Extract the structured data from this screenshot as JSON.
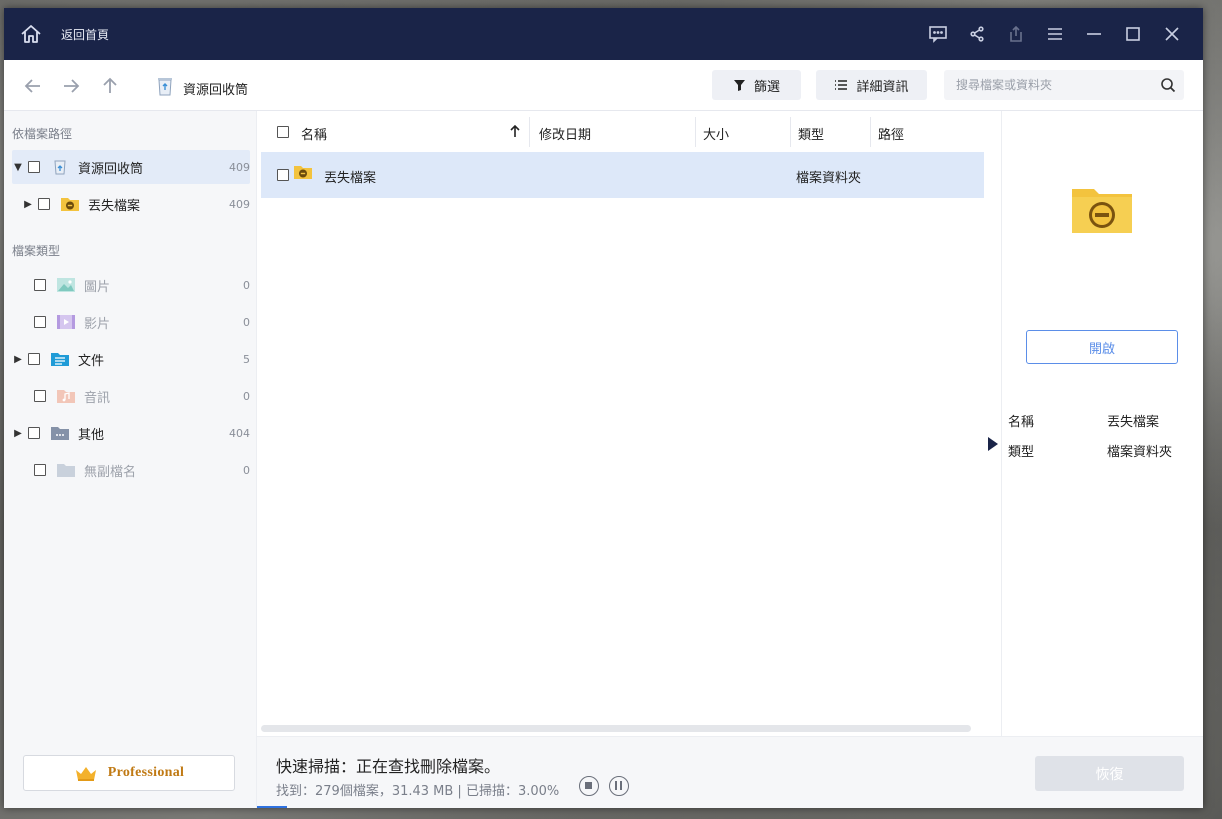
{
  "titlebar": {
    "back_home_label": "返回首頁",
    "icons": [
      "feedback-icon",
      "share-icon",
      "export-icon",
      "menu-icon",
      "minimize-icon",
      "maximize-icon",
      "close-icon"
    ]
  },
  "toolbar": {
    "current_path": "資源回收筒",
    "filter_label": "篩選",
    "details_label": "詳細資訊",
    "search_placeholder": "搜尋檔案或資料夾"
  },
  "sidebar": {
    "path_section": "依檔案路徑",
    "path_items": [
      {
        "label": "資源回收筒",
        "count": "409"
      },
      {
        "label": "丟失檔案",
        "count": "409"
      }
    ],
    "type_section": "檔案類型",
    "type_items": [
      {
        "label": "圖片",
        "count": "0"
      },
      {
        "label": "影片",
        "count": "0"
      },
      {
        "label": "文件",
        "count": "5"
      },
      {
        "label": "音訊",
        "count": "0"
      },
      {
        "label": "其他",
        "count": "404"
      },
      {
        "label": "無副檔名",
        "count": "0"
      }
    ],
    "professional_label": "Professional"
  },
  "file_list": {
    "columns": [
      "名稱",
      "修改日期",
      "大小",
      "類型",
      "路徑"
    ],
    "rows": [
      {
        "name": "丟失檔案",
        "date": "",
        "size": "",
        "type": "檔案資料夾",
        "path": ""
      }
    ]
  },
  "details": {
    "open_label": "開啟",
    "props": [
      {
        "key": "名稱",
        "value": "丟失檔案"
      },
      {
        "key": "類型",
        "value": "檔案資料夾"
      }
    ]
  },
  "status": {
    "title": "快速掃描：正在查找刪除檔案。",
    "summary": "找到：279個檔案，31.43 MB | 已掃描：3.00%",
    "recover_label": "恢復"
  },
  "colors": {
    "titlebar": "#1a2448",
    "accent": "#2f72e0",
    "selection": "#dde8f9",
    "folder": "#f3c33e"
  }
}
